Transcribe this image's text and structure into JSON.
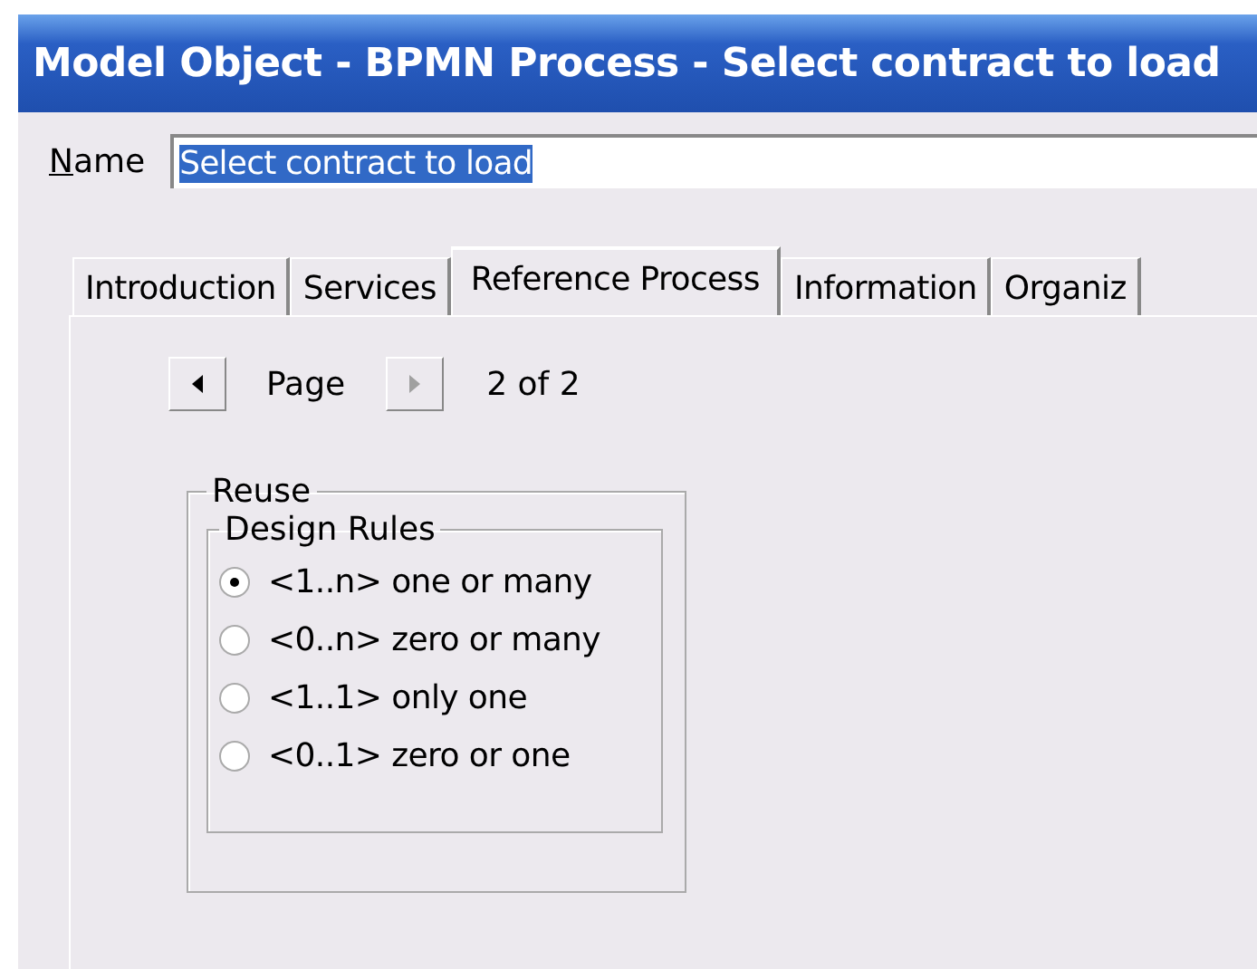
{
  "window": {
    "title": "Model Object - BPMN Process - Select contract to load"
  },
  "name_field": {
    "label": "Name",
    "value": "Select contract to load",
    "selected": true
  },
  "tabs": [
    {
      "label": "Introduction",
      "selected": false
    },
    {
      "label": "Services",
      "selected": false
    },
    {
      "label": "Reference Process",
      "selected": true
    },
    {
      "label": "Information",
      "selected": false
    },
    {
      "label": "Organiz",
      "selected": false
    }
  ],
  "pager": {
    "prev_disabled": false,
    "label": "Page",
    "next_disabled": true,
    "status": "2 of 2"
  },
  "reuse": {
    "title": "Reuse",
    "design_rules": {
      "title": "Design Rules",
      "options": [
        {
          "label": "<1..n> one or many",
          "selected": true
        },
        {
          "label": "<0..n> zero or many",
          "selected": false
        },
        {
          "label": "<1..1> only one",
          "selected": false
        },
        {
          "label": "<0..1> zero or one",
          "selected": false
        }
      ]
    }
  }
}
